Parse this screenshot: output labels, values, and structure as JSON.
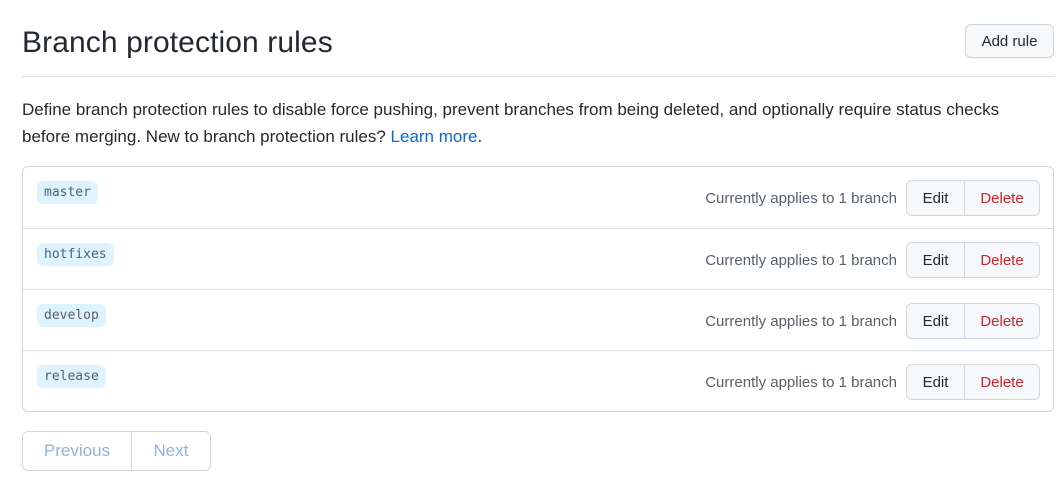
{
  "header": {
    "title": "Branch protection rules",
    "add_rule_label": "Add rule"
  },
  "description": {
    "text": "Define branch protection rules to disable force pushing, prevent branches from being deleted, and optionally require status checks before merging. New to branch protection rules? ",
    "link_label": "Learn more",
    "trailing": "."
  },
  "rules": [
    {
      "branch": "master",
      "applies": "Currently applies to 1 branch",
      "edit_label": "Edit",
      "delete_label": "Delete"
    },
    {
      "branch": "hotfixes",
      "applies": "Currently applies to 1 branch",
      "edit_label": "Edit",
      "delete_label": "Delete"
    },
    {
      "branch": "develop",
      "applies": "Currently applies to 1 branch",
      "edit_label": "Edit",
      "delete_label": "Delete"
    },
    {
      "branch": "release",
      "applies": "Currently applies to 1 branch",
      "edit_label": "Edit",
      "delete_label": "Delete"
    }
  ],
  "pagination": {
    "previous_label": "Previous",
    "next_label": "Next",
    "previous_enabled": false,
    "next_enabled": false
  },
  "colors": {
    "link": "#0969da",
    "danger": "#cf222e",
    "branch_badge_bg": "#ddf4ff",
    "disabled_pager_text": "#8fb4e0"
  }
}
